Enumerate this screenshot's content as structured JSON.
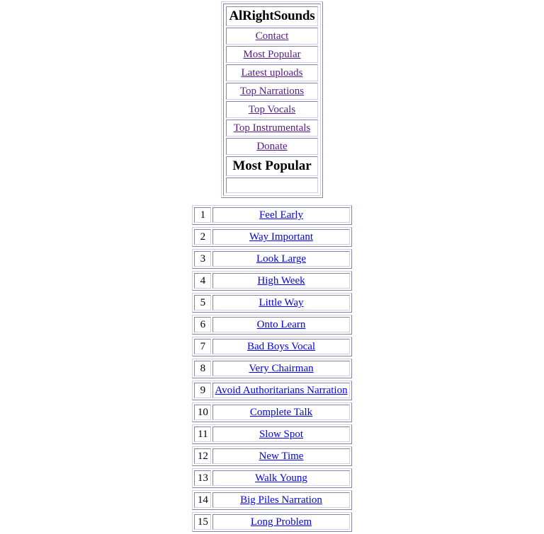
{
  "site": {
    "title": "AlRightSounds"
  },
  "nav": {
    "items": [
      {
        "label": "Contact"
      },
      {
        "label": "Most Popular"
      },
      {
        "label": "Latest uploads"
      },
      {
        "label": "Top Narrations"
      },
      {
        "label": "Top Vocals"
      },
      {
        "label": "Top Instrumentals"
      },
      {
        "label": "Donate"
      }
    ],
    "section_heading": "Most Popular",
    "empty_cell": ""
  },
  "list": {
    "rows": [
      {
        "rank": "1",
        "title": "Feel Early"
      },
      {
        "rank": "2",
        "title": "Way Important"
      },
      {
        "rank": "3",
        "title": "Look Large"
      },
      {
        "rank": "4",
        "title": "High Week"
      },
      {
        "rank": "5",
        "title": "Little Way"
      },
      {
        "rank": "6",
        "title": "Onto Learn"
      },
      {
        "rank": "7",
        "title": "Bad Boys Vocal"
      },
      {
        "rank": "8",
        "title": "Very Chairman"
      },
      {
        "rank": "9",
        "title": "Avoid Authoritarians Narration"
      },
      {
        "rank": "10",
        "title": "Complete Talk"
      },
      {
        "rank": "11",
        "title": "Slow Spot"
      },
      {
        "rank": "12",
        "title": "New Time"
      },
      {
        "rank": "13",
        "title": "Walk Young"
      },
      {
        "rank": "14",
        "title": "Big Piles Narration"
      },
      {
        "rank": "15",
        "title": "Long Problem"
      }
    ]
  },
  "colors": {
    "link_unvisited": "#0000ee",
    "link_visited": "#551a8b",
    "border": "#ccccee",
    "background": "#ffffff"
  }
}
